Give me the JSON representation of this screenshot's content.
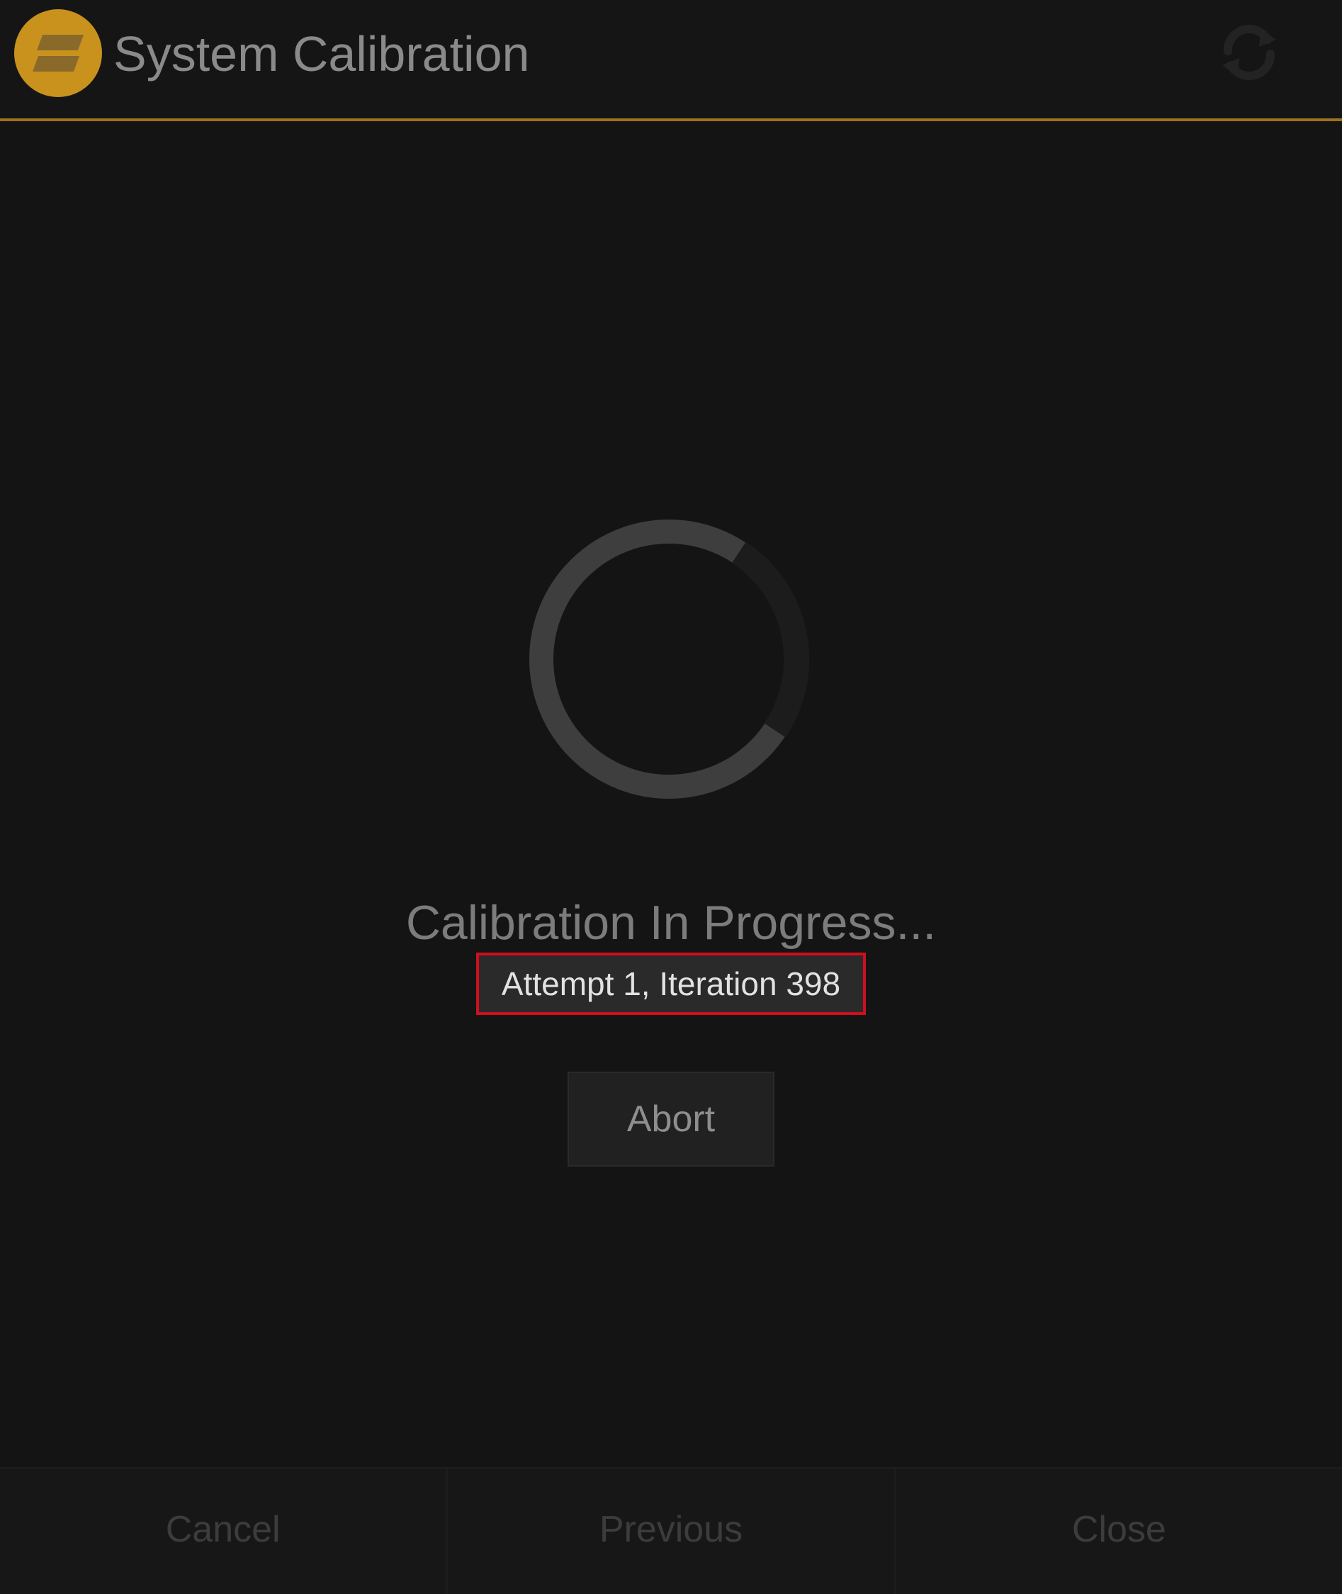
{
  "header": {
    "title": "System Calibration",
    "logo_icon": "calibration-logo-icon",
    "refresh_icon": "refresh-icon"
  },
  "main": {
    "spinner_icon": "loading-spinner-icon",
    "status_title": "Calibration In Progress...",
    "status_detail": "Attempt 1, Iteration 398",
    "abort_label": "Abort"
  },
  "footer": {
    "cancel_label": "Cancel",
    "previous_label": "Previous",
    "close_label": "Close"
  },
  "colors": {
    "background": "#141414",
    "accent": "#a0701e",
    "logo": "#c8921c",
    "highlight_border": "#cf0e1e"
  }
}
